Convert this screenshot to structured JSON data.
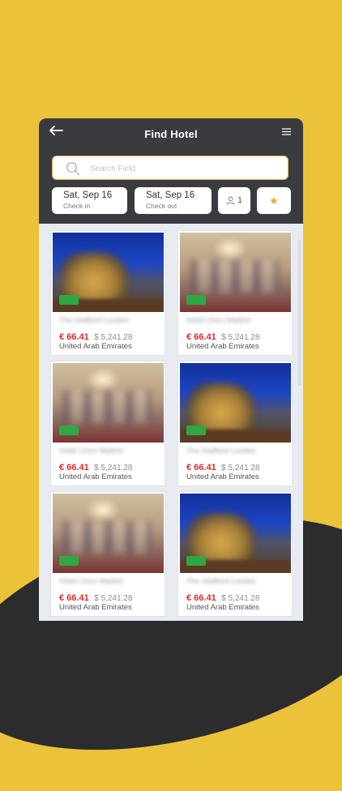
{
  "header": {
    "title": "Find Hotel"
  },
  "search": {
    "placeholder": "Search Field"
  },
  "check_in": {
    "date": "Sat, Sep 16",
    "label": "Check in"
  },
  "check_out": {
    "date": "Sat, Sep 16",
    "label": "Check out"
  },
  "guests": {
    "count": "1"
  },
  "colors": {
    "brand_yellow": "#ecc23a",
    "header_dark": "#3a3b3e",
    "price_red": "#e02a2a",
    "badge_green": "#2ea844"
  },
  "hotels": [
    {
      "name": "The Stafford London",
      "price": "€ 66.41",
      "old_price": "$ 5,241.28",
      "location": "United Arab Emirates",
      "image": "hotel-exterior-night"
    },
    {
      "name": "Hotel Urico Madrid",
      "price": "€ 66.41",
      "old_price": "$ 5,241.28",
      "location": "United Arab Emirates",
      "image": "hotel-interior"
    },
    {
      "name": "Hotel Urico Madrid",
      "price": "€ 66.41",
      "old_price": "$ 5,241.28",
      "location": "United Arab Emirates",
      "image": "hotel-interior"
    },
    {
      "name": "The Stafford London",
      "price": "€ 66.41",
      "old_price": "$ 5,241.28",
      "location": "United Arab Emirates",
      "image": "hotel-exterior-night"
    },
    {
      "name": "Hotel Urico Madrid",
      "price": "€ 66.41",
      "old_price": "$ 5,241.28",
      "location": "United Arab Emirates",
      "image": "hotel-interior"
    },
    {
      "name": "The Stafford London",
      "price": "€ 66.41",
      "old_price": "$ 5,241.28",
      "location": "United Arab Emirates",
      "image": "hotel-exterior-night"
    }
  ]
}
